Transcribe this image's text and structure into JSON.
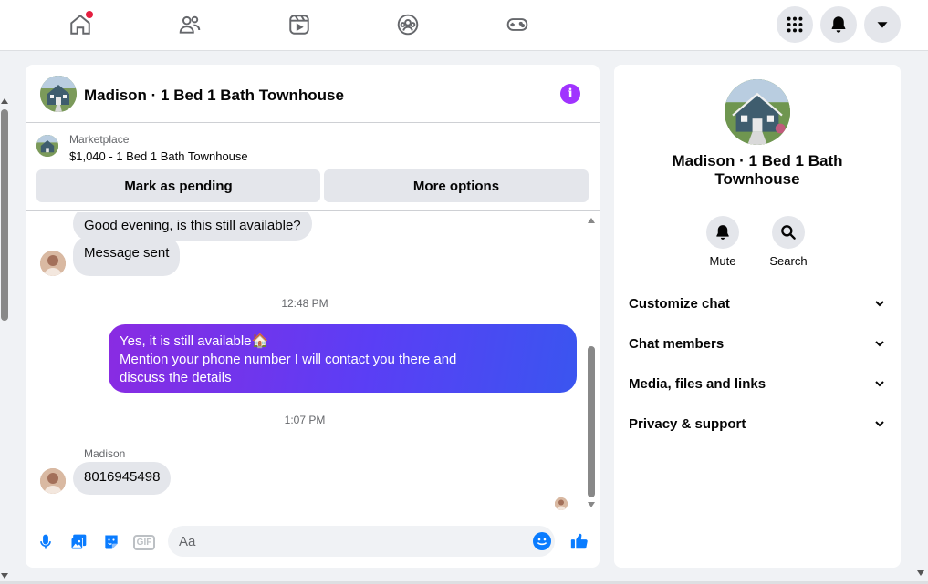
{
  "chat": {
    "title": "Madison · 1 Bed 1 Bath Townhouse",
    "listing": {
      "source": "Marketplace",
      "price_title": "$1,040 - 1 Bed 1 Bath Townhouse",
      "pending_label": "Mark as pending",
      "more_label": "More options"
    },
    "messages": {
      "first_in": "Good evening, is this still available?",
      "second_in": "Message sent",
      "time_1": "12:48 PM",
      "out_line_1": "Yes, it is still available🏠",
      "out_line_2": "Mention your phone number I will contact you there and",
      "out_line_3": "discuss the details",
      "time_2": "1:07 PM",
      "sender_name": "Madison",
      "phone_msg": "8016945498"
    },
    "composer": {
      "placeholder": "Aa",
      "gif_label": "GIF"
    }
  },
  "info_panel": {
    "name": "Madison · 1 Bed 1 Bath Townhouse",
    "mute_label": "Mute",
    "search_label": "Search",
    "sections": [
      "Customize chat",
      "Chat members",
      "Media, files and links",
      "Privacy & support"
    ]
  },
  "colors": {
    "accent": "#0a7cff",
    "outgoing_gradient_start": "#8a2be2",
    "outgoing_gradient_end": "#3a55f0",
    "info_icon": "#a033ff",
    "notification_dot": "#e41e3f"
  },
  "icons": {
    "nav": [
      "home-icon",
      "friends-icon",
      "video-icon",
      "groups-icon",
      "gaming-icon"
    ],
    "right_nav": [
      "menu-grid-icon",
      "bell-icon",
      "chevron-down-icon"
    ]
  }
}
